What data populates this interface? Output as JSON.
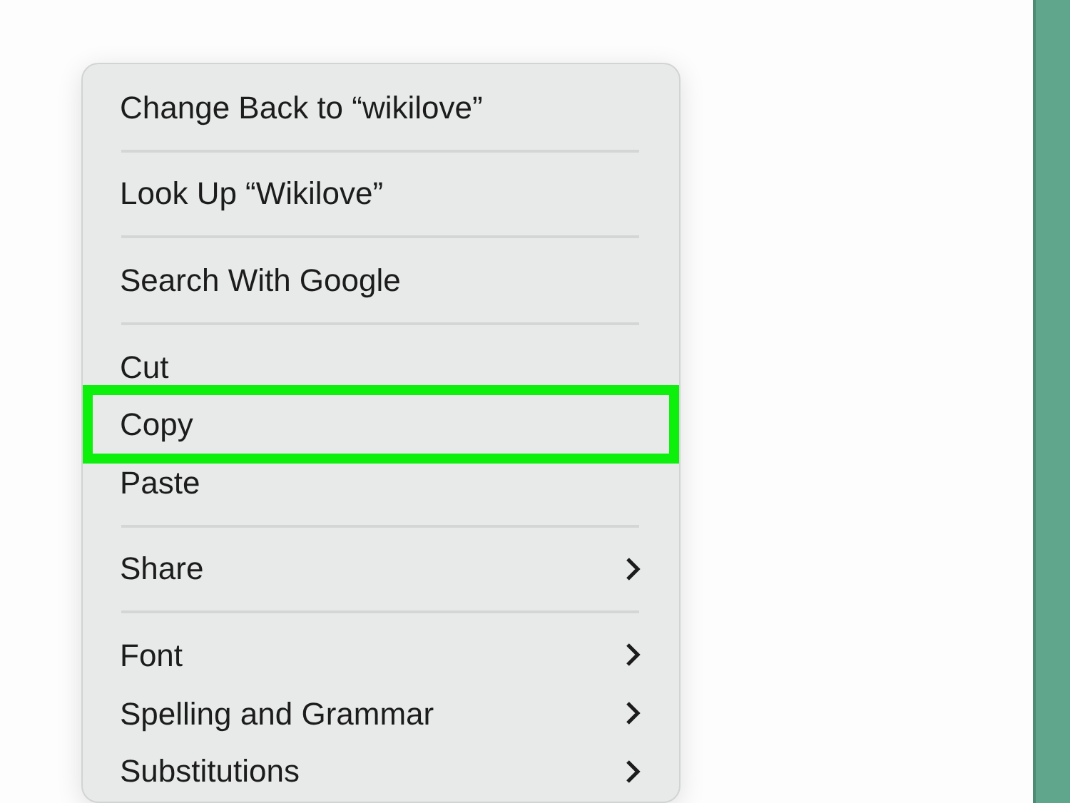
{
  "context_menu": {
    "groups": [
      {
        "items": [
          {
            "label": "Change Back to “wikilove”",
            "submenu": false,
            "highlighted": false
          }
        ]
      },
      {
        "items": [
          {
            "label": "Look Up “Wikilove”",
            "submenu": false,
            "highlighted": false
          }
        ]
      },
      {
        "items": [
          {
            "label": "Search With Google",
            "submenu": false,
            "highlighted": false
          }
        ]
      },
      {
        "items": [
          {
            "label": "Cut",
            "submenu": false,
            "highlighted": false
          },
          {
            "label": "Copy",
            "submenu": false,
            "highlighted": true
          },
          {
            "label": "Paste",
            "submenu": false,
            "highlighted": false
          }
        ]
      },
      {
        "items": [
          {
            "label": "Share",
            "submenu": true,
            "highlighted": false
          }
        ]
      },
      {
        "items": [
          {
            "label": "Font",
            "submenu": true,
            "highlighted": false
          },
          {
            "label": "Spelling and Grammar",
            "submenu": true,
            "highlighted": false
          },
          {
            "label": "Substitutions",
            "submenu": true,
            "highlighted": false
          }
        ]
      }
    ]
  }
}
